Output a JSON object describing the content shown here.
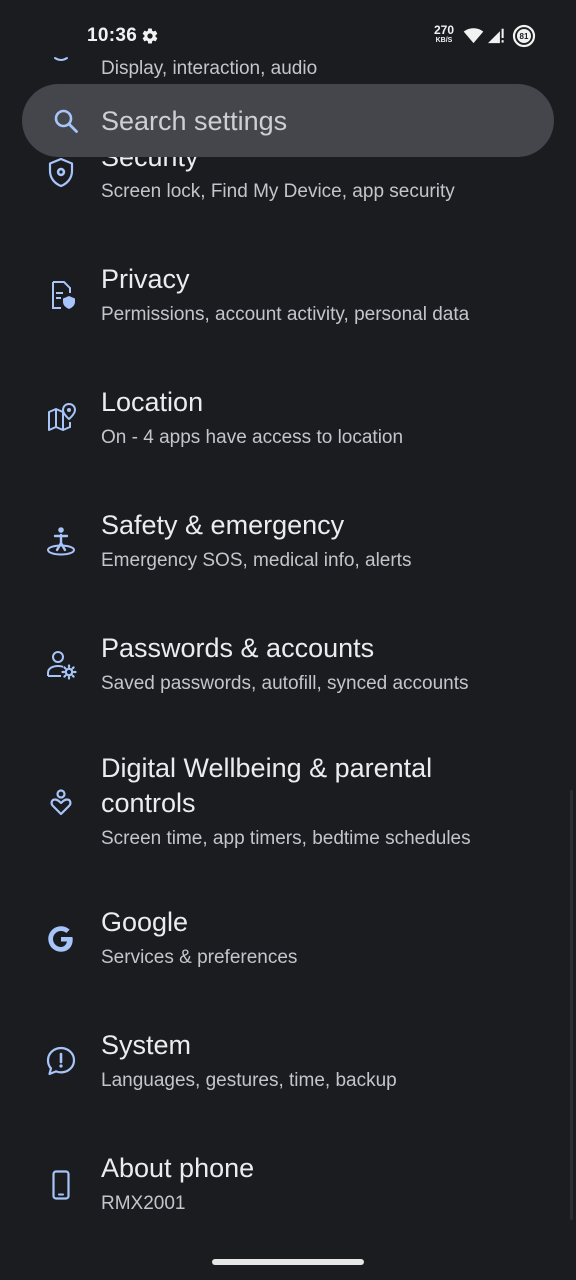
{
  "status_bar": {
    "time": "10:36",
    "net_speed": "270",
    "net_unit": "KB/S",
    "battery": "81"
  },
  "search": {
    "placeholder": "Search settings"
  },
  "colors": {
    "background": "#1b1c20",
    "search_bg": "#45464c",
    "icon_accent": "#a7c5f8",
    "title_text": "#ecebf0",
    "subtitle_text": "#c5c4cb"
  },
  "items": [
    {
      "title": "",
      "subtitle": "Display, interaction, audio",
      "icon": "accessibility-icon"
    },
    {
      "title": "Security",
      "subtitle": "Screen lock, Find My Device, app security",
      "icon": "shield-icon"
    },
    {
      "title": "Privacy",
      "subtitle": "Permissions, account activity, personal data",
      "icon": "privacy-icon"
    },
    {
      "title": "Location",
      "subtitle": "On - 4 apps have access to location",
      "icon": "location-map-icon"
    },
    {
      "title": "Safety & emergency",
      "subtitle": "Emergency SOS, medical info, alerts",
      "icon": "safety-icon"
    },
    {
      "title": "Passwords & accounts",
      "subtitle": "Saved passwords, autofill, synced accounts",
      "icon": "account-settings-icon"
    },
    {
      "title_line1": "Digital Wellbeing & parental",
      "title_line2": "controls",
      "subtitle": "Screen time, app timers, bedtime schedules",
      "icon": "wellbeing-icon"
    },
    {
      "title": "Google",
      "subtitle": "Services & preferences",
      "icon": "google-icon"
    },
    {
      "title": "System",
      "subtitle": "Languages, gestures, time, backup",
      "icon": "system-info-icon"
    },
    {
      "title": "About phone",
      "subtitle": "RMX2001",
      "icon": "phone-icon"
    }
  ]
}
